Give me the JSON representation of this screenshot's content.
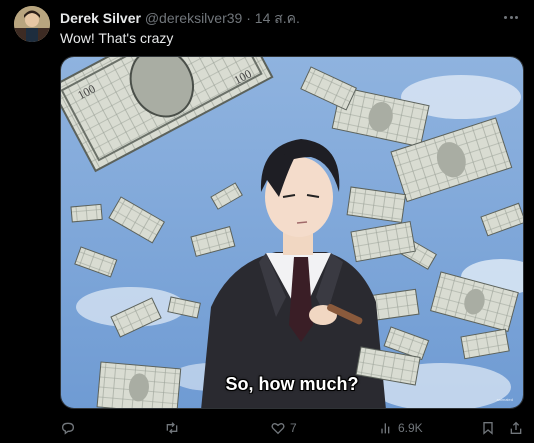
{
  "tweet": {
    "author_name": "Derek Silver",
    "handle": "@dereksilver39",
    "separator": "·",
    "date": "14 ส.ค.",
    "text": "Wow! That's crazy",
    "media": {
      "caption": "So, how much?",
      "watermark": "animated"
    },
    "actions": {
      "reply_count": "",
      "retweet_count": "",
      "like_count": "7",
      "views_count": "6.9K"
    }
  },
  "colors": {
    "background": "#000000",
    "primary_text": "#e7e9ea",
    "secondary_text": "#71767b",
    "sky": "#7fa6d6"
  },
  "icons": [
    "avatar",
    "more-icon",
    "reply-icon",
    "retweet-icon",
    "like-icon",
    "views-icon",
    "bookmark-icon",
    "share-icon"
  ]
}
